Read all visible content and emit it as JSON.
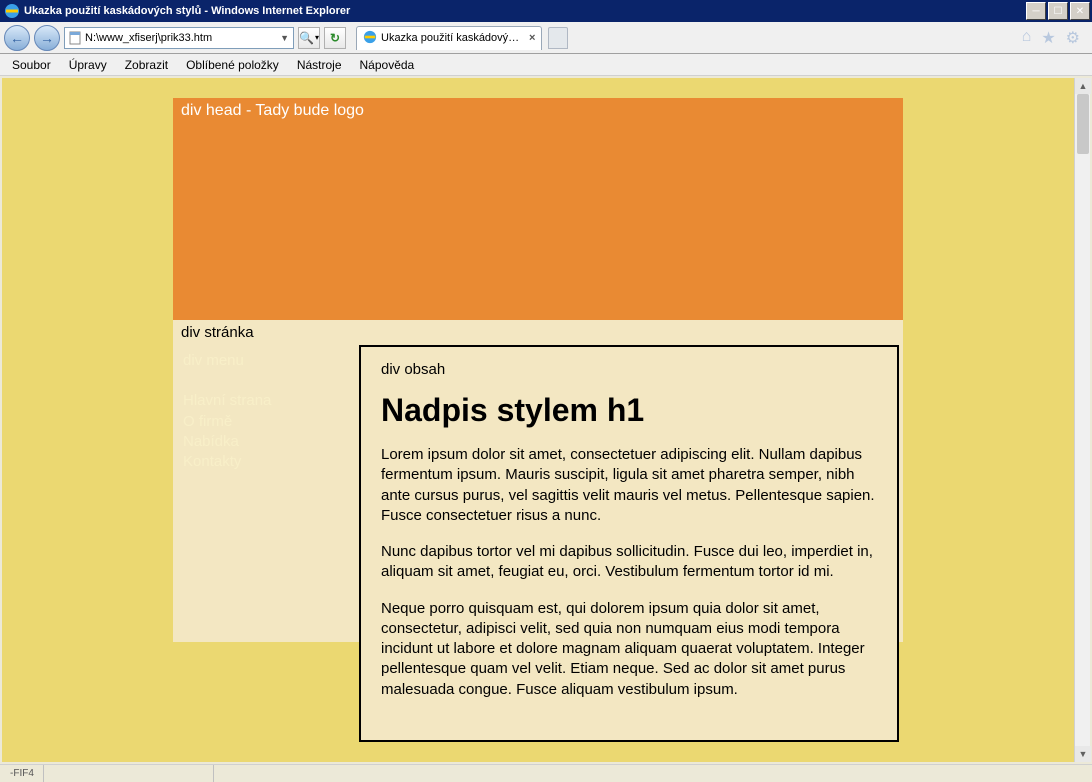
{
  "window": {
    "title": "Ukazka použití kaskádových stylů - Windows Internet Explorer"
  },
  "nav": {
    "address": "N:\\www_xfiserj\\prik33.htm",
    "search_symbol": "🔍"
  },
  "tabs": {
    "active_label": "Ukazka použití kaskádových ..."
  },
  "menubar": {
    "items": [
      "Soubor",
      "Úpravy",
      "Zobrazit",
      "Oblíbené položky",
      "Nástroje",
      "Nápověda"
    ]
  },
  "page": {
    "head_text": "div head - Tady bude logo",
    "stranka_label": "div stránka",
    "menu": {
      "label": "div menu",
      "items": [
        "Hlavní strana",
        "O firmě",
        "Nabídka",
        "Kontakty"
      ]
    },
    "obsah": {
      "label": "div obsah",
      "heading": "Nadpis stylem h1",
      "para1": "Lorem ipsum dolor sit amet, consectetuer adipiscing elit. Nullam dapibus fermentum ipsum. Mauris suscipit, ligula sit amet pharetra semper, nibh ante cursus purus, vel sagittis velit mauris vel metus. Pellentesque sapien. Fusce consectetuer risus a nunc.",
      "para2": "Nunc dapibus tortor vel mi dapibus sollicitudin. Fusce dui leo, imperdiet in, aliquam sit amet, feugiat eu, orci. Vestibulum fermentum tortor id mi.",
      "para3": "Neque porro quisquam est, qui dolorem ipsum quia dolor sit amet, consectetur, adipisci velit, sed quia non numquam eius modi tempora incidunt ut labore et dolore magnam aliquam quaerat voluptatem. Integer pellentesque quam vel velit. Etiam neque. Sed ac dolor sit amet purus malesuada congue. Fusce aliquam vestibulum ipsum."
    }
  },
  "status": {
    "left": "-FIF4"
  },
  "colors": {
    "page_bg": "#ebd871",
    "head_bg": "#e98a33",
    "content_bg": "#f3e7c2",
    "menu_text": "#f8efc8"
  }
}
